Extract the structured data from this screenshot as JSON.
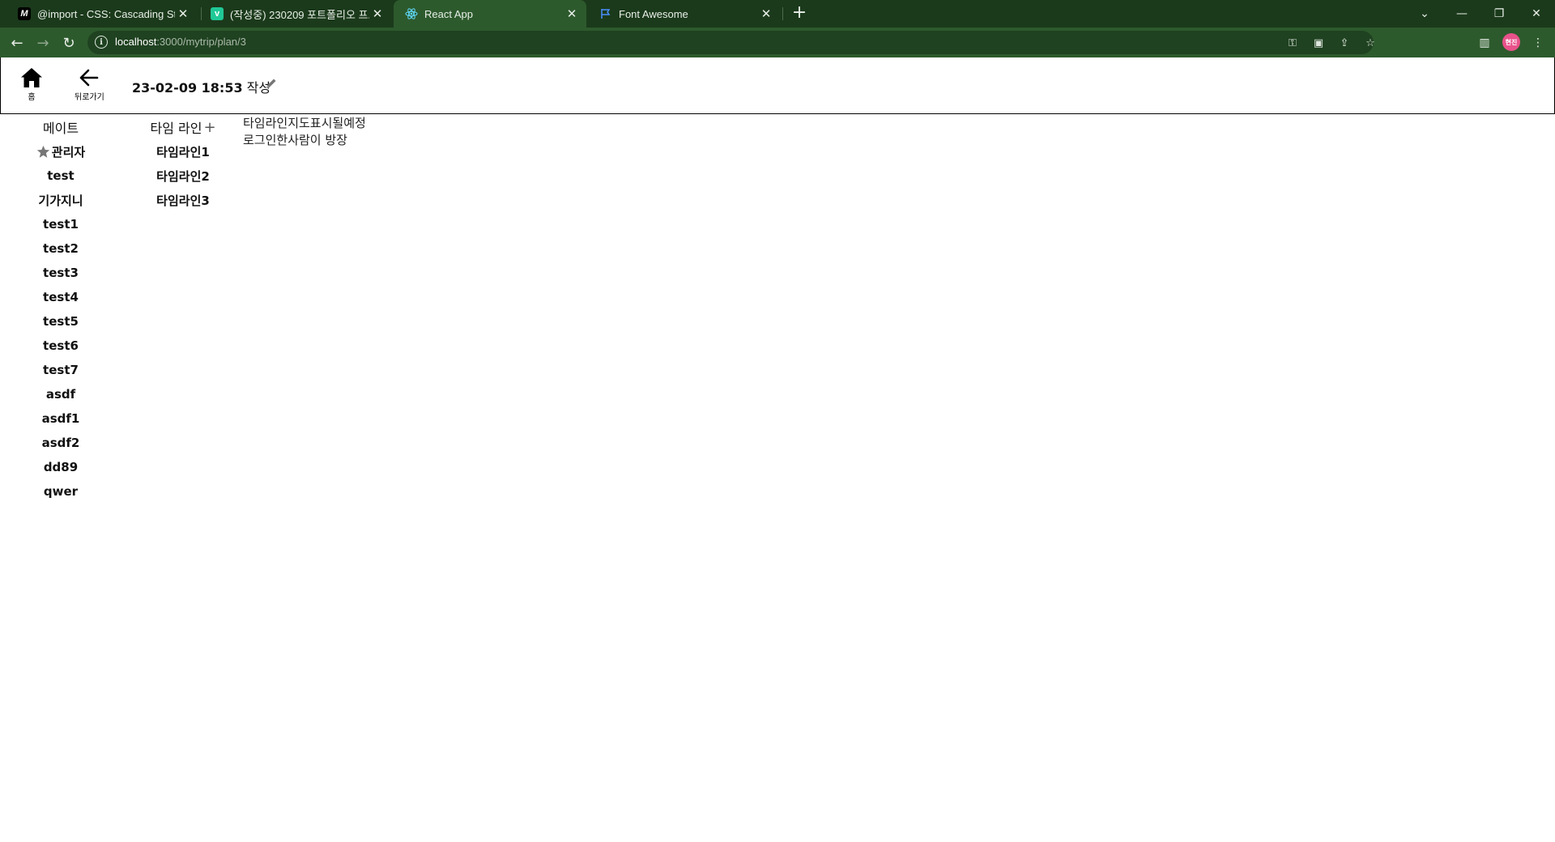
{
  "browser": {
    "tabs": [
      {
        "title": "@import - CSS: Cascading Style",
        "favicon": "mdn-icon",
        "active": false
      },
      {
        "title": "(작성중) 230209 포트폴리오 프로",
        "favicon": "velog-icon",
        "active": false
      },
      {
        "title": "React App",
        "favicon": "react-icon",
        "active": true
      },
      {
        "title": "Font Awesome",
        "favicon": "flag-icon",
        "active": false
      }
    ],
    "url_host": "localhost",
    "url_path": ":3000/mytrip/plan/3",
    "profile_initials": "현진",
    "colors": {
      "frame": "#1b3a1b",
      "toolbar": "#2d5a2d",
      "omnibox": "#1f4220",
      "avatar": "#e8528a"
    }
  },
  "header": {
    "home_label": "홈",
    "back_label": "뒤로가기",
    "title": "23-02-09 18:53",
    "title_suffix": " 작성"
  },
  "mates": {
    "heading": "메이트",
    "admin": "관리자",
    "members": [
      "test",
      "기가지니",
      "test1",
      "test2",
      "test3",
      "test4",
      "test5",
      "test6",
      "test7",
      "asdf",
      "asdf1",
      "asdf2",
      "dd89",
      "qwer"
    ]
  },
  "timelines": {
    "heading": "타임 라인",
    "add_symbol": "+",
    "items": [
      "타임라인1",
      "타임라인2",
      "타임라인3"
    ]
  },
  "main": {
    "line1": "타임라인지도표시될예정",
    "line2": "로그인한사람이 방장"
  }
}
